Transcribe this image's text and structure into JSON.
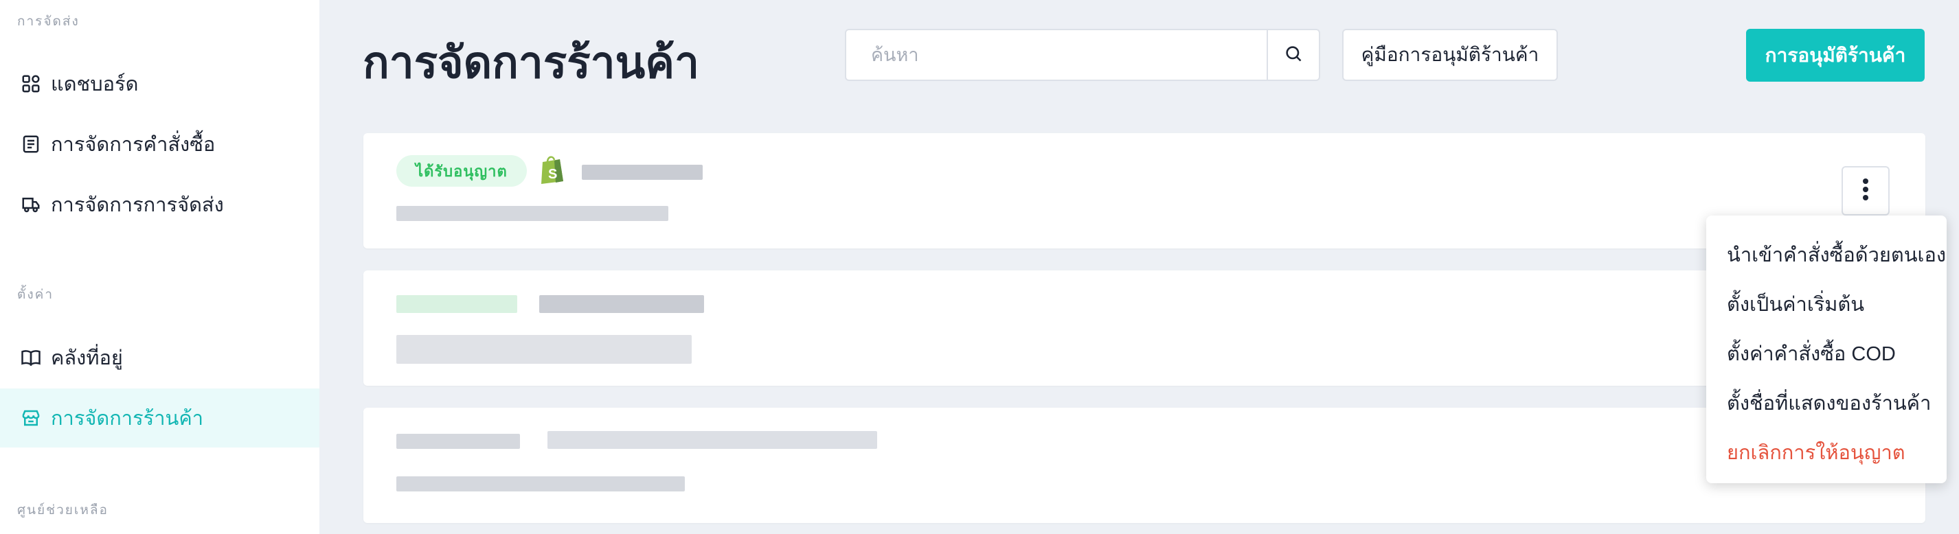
{
  "sidebar": {
    "sections": [
      {
        "label": "การจัดส่ง",
        "items": [
          {
            "label": "แดชบอร์ด",
            "icon": "dashboard-icon"
          },
          {
            "label": "การจัดการคำสั่งซื้อ",
            "icon": "clipboard-icon"
          },
          {
            "label": "การจัดการการจัดส่ง",
            "icon": "truck-icon"
          }
        ]
      },
      {
        "label": "ตั้งค่า",
        "items": [
          {
            "label": "คลังที่อยู่",
            "icon": "book-icon"
          },
          {
            "label": "การจัดการร้านค้า",
            "icon": "store-icon",
            "active": true
          }
        ]
      },
      {
        "label": "ศูนย์ช่วยเหลือ",
        "items": []
      }
    ]
  },
  "header": {
    "title": "การจัดการร้านค้า",
    "search_placeholder": "ค้นหา",
    "guide_button": "คู่มือการอนุมัติร้านค้า",
    "primary_button": "การอนุมัติร้านค้า"
  },
  "stores": [
    {
      "status_badge": "ได้รับอนุญาต",
      "platform_icon": "shopify-icon"
    }
  ],
  "dropdown_menu": {
    "items": [
      {
        "label": "นำเข้าคำสั่งซื้อด้วยตนเอง"
      },
      {
        "label": "ตั้งเป็นค่าเริ่มต้น"
      },
      {
        "label": "ตั้งค่าคำสั่งซื้อ COD"
      },
      {
        "label": "ตั้งชื่อที่แสดงของร้านค้า"
      },
      {
        "label": "ยกเลิกการให้อนุญาต",
        "danger": true
      }
    ]
  },
  "colors": {
    "accent": "#12c3bf",
    "active_bg": "#e9fafa",
    "badge_bg": "#e4f9ec",
    "badge_text": "#2fbf60",
    "danger": "#e5533d",
    "page_bg": "#edf0f5"
  }
}
